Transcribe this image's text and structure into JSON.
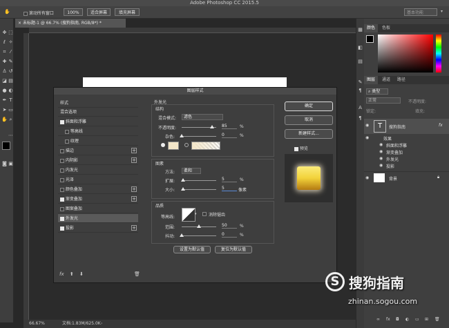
{
  "app": {
    "title": "Adobe Photoshop CC 2015.5"
  },
  "options_bar": {
    "scroll_all_label": "滚动所有窗口",
    "zoom_100": "100%",
    "fit_screen": "适合屏幕",
    "fill_screen": "填充屏幕",
    "workspace": "基本功能"
  },
  "document": {
    "tab_title": "未标题-1 @ 66.7% (搜狗指南, RGB/8*) *",
    "zoom": "66.67%",
    "doc_info": "文档:1.83M/625.0K"
  },
  "right_panel": {
    "tabs_top": [
      "颜色",
      "色板"
    ],
    "tabs_layers": [
      "图层",
      "通道",
      "路径"
    ],
    "kind_filter": "类型",
    "blend_mode": "正常",
    "opacity_label": "不透明度:",
    "lock_label": "锁定:",
    "fill_label": "填充:",
    "layers": [
      {
        "name": "搜狗指南",
        "type": "text",
        "fx": "fx"
      },
      {
        "name": "效果"
      },
      {
        "name": "斜面和浮雕"
      },
      {
        "name": "渐变叠加"
      },
      {
        "name": "外发光"
      },
      {
        "name": "投影"
      },
      {
        "name": "背景",
        "type": "background"
      }
    ]
  },
  "dialog": {
    "title": "图层样式",
    "styles_header": "样式",
    "blend_options": "混合选项",
    "styles": [
      {
        "label": "斜面和浮雕",
        "checked": true
      },
      {
        "label": "等高线",
        "checked": false,
        "indent": true
      },
      {
        "label": "纹理",
        "checked": false,
        "indent": true
      },
      {
        "label": "描边",
        "checked": false,
        "plus": true
      },
      {
        "label": "内阴影",
        "checked": false,
        "plus": true
      },
      {
        "label": "内发光",
        "checked": false
      },
      {
        "label": "光泽",
        "checked": false
      },
      {
        "label": "颜色叠加",
        "checked": false,
        "plus": true
      },
      {
        "label": "渐变叠加",
        "checked": true,
        "plus": true
      },
      {
        "label": "图案叠加",
        "checked": false
      },
      {
        "label": "外发光",
        "checked": true,
        "selected": true
      },
      {
        "label": "投影",
        "checked": true,
        "plus": true
      }
    ],
    "footer_fx": "fx",
    "section_title": "外发光",
    "structure": {
      "title": "结构",
      "blend_label": "混合模式:",
      "blend_value": "滤色",
      "opacity_label": "不透明度:",
      "opacity_value": "85",
      "noise_label": "杂色:",
      "noise_value": "0",
      "percent": "%"
    },
    "elements": {
      "title": "图素",
      "method_label": "方法:",
      "method_value": "柔和",
      "spread_label": "扩展:",
      "spread_value": "5",
      "size_label": "大小:",
      "size_value": "5",
      "px": "像素",
      "percent": "%"
    },
    "quality": {
      "title": "品质",
      "contour_label": "等高线:",
      "antialias_label": "消除锯齿",
      "range_label": "范围:",
      "range_value": "50",
      "jitter_label": "抖动:",
      "jitter_value": "0",
      "percent": "%"
    },
    "set_default": "设置为默认值",
    "reset_default": "复位为默认值",
    "ok": "确定",
    "cancel": "取消",
    "new_style": "新建样式...",
    "preview": "预览"
  },
  "watermark": {
    "brand": "搜狗指南",
    "url": "zhinan.sogou.com"
  },
  "colors": {
    "accent": "#5b8ad6",
    "glow_yellow": "#f2d23a",
    "panel_bg": "#3e3e3e"
  }
}
